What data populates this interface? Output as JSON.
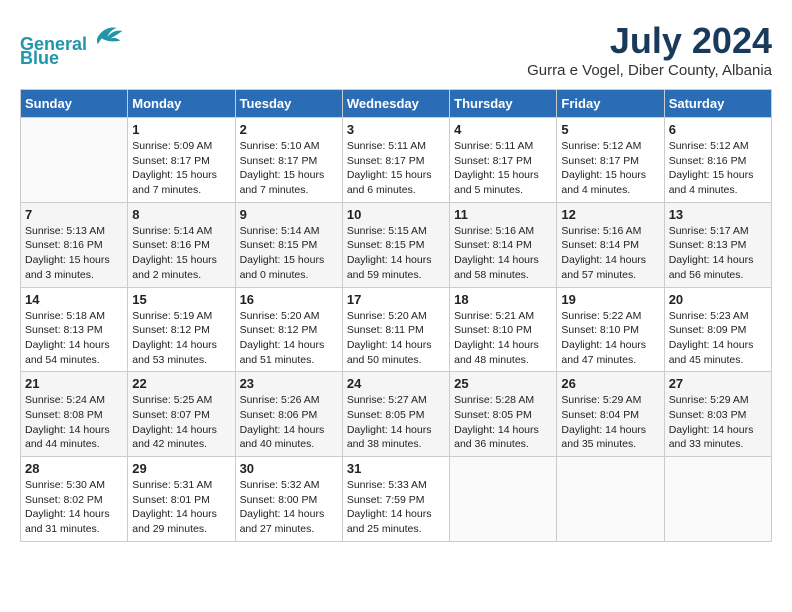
{
  "header": {
    "logo_line1": "General",
    "logo_line2": "Blue",
    "month_year": "July 2024",
    "location": "Gurra e Vogel, Diber County, Albania"
  },
  "weekdays": [
    "Sunday",
    "Monday",
    "Tuesday",
    "Wednesday",
    "Thursday",
    "Friday",
    "Saturday"
  ],
  "weeks": [
    [
      {
        "day": "",
        "info": ""
      },
      {
        "day": "1",
        "info": "Sunrise: 5:09 AM\nSunset: 8:17 PM\nDaylight: 15 hours\nand 7 minutes."
      },
      {
        "day": "2",
        "info": "Sunrise: 5:10 AM\nSunset: 8:17 PM\nDaylight: 15 hours\nand 7 minutes."
      },
      {
        "day": "3",
        "info": "Sunrise: 5:11 AM\nSunset: 8:17 PM\nDaylight: 15 hours\nand 6 minutes."
      },
      {
        "day": "4",
        "info": "Sunrise: 5:11 AM\nSunset: 8:17 PM\nDaylight: 15 hours\nand 5 minutes."
      },
      {
        "day": "5",
        "info": "Sunrise: 5:12 AM\nSunset: 8:17 PM\nDaylight: 15 hours\nand 4 minutes."
      },
      {
        "day": "6",
        "info": "Sunrise: 5:12 AM\nSunset: 8:16 PM\nDaylight: 15 hours\nand 4 minutes."
      }
    ],
    [
      {
        "day": "7",
        "info": "Sunrise: 5:13 AM\nSunset: 8:16 PM\nDaylight: 15 hours\nand 3 minutes."
      },
      {
        "day": "8",
        "info": "Sunrise: 5:14 AM\nSunset: 8:16 PM\nDaylight: 15 hours\nand 2 minutes."
      },
      {
        "day": "9",
        "info": "Sunrise: 5:14 AM\nSunset: 8:15 PM\nDaylight: 15 hours\nand 0 minutes."
      },
      {
        "day": "10",
        "info": "Sunrise: 5:15 AM\nSunset: 8:15 PM\nDaylight: 14 hours\nand 59 minutes."
      },
      {
        "day": "11",
        "info": "Sunrise: 5:16 AM\nSunset: 8:14 PM\nDaylight: 14 hours\nand 58 minutes."
      },
      {
        "day": "12",
        "info": "Sunrise: 5:16 AM\nSunset: 8:14 PM\nDaylight: 14 hours\nand 57 minutes."
      },
      {
        "day": "13",
        "info": "Sunrise: 5:17 AM\nSunset: 8:13 PM\nDaylight: 14 hours\nand 56 minutes."
      }
    ],
    [
      {
        "day": "14",
        "info": "Sunrise: 5:18 AM\nSunset: 8:13 PM\nDaylight: 14 hours\nand 54 minutes."
      },
      {
        "day": "15",
        "info": "Sunrise: 5:19 AM\nSunset: 8:12 PM\nDaylight: 14 hours\nand 53 minutes."
      },
      {
        "day": "16",
        "info": "Sunrise: 5:20 AM\nSunset: 8:12 PM\nDaylight: 14 hours\nand 51 minutes."
      },
      {
        "day": "17",
        "info": "Sunrise: 5:20 AM\nSunset: 8:11 PM\nDaylight: 14 hours\nand 50 minutes."
      },
      {
        "day": "18",
        "info": "Sunrise: 5:21 AM\nSunset: 8:10 PM\nDaylight: 14 hours\nand 48 minutes."
      },
      {
        "day": "19",
        "info": "Sunrise: 5:22 AM\nSunset: 8:10 PM\nDaylight: 14 hours\nand 47 minutes."
      },
      {
        "day": "20",
        "info": "Sunrise: 5:23 AM\nSunset: 8:09 PM\nDaylight: 14 hours\nand 45 minutes."
      }
    ],
    [
      {
        "day": "21",
        "info": "Sunrise: 5:24 AM\nSunset: 8:08 PM\nDaylight: 14 hours\nand 44 minutes."
      },
      {
        "day": "22",
        "info": "Sunrise: 5:25 AM\nSunset: 8:07 PM\nDaylight: 14 hours\nand 42 minutes."
      },
      {
        "day": "23",
        "info": "Sunrise: 5:26 AM\nSunset: 8:06 PM\nDaylight: 14 hours\nand 40 minutes."
      },
      {
        "day": "24",
        "info": "Sunrise: 5:27 AM\nSunset: 8:05 PM\nDaylight: 14 hours\nand 38 minutes."
      },
      {
        "day": "25",
        "info": "Sunrise: 5:28 AM\nSunset: 8:05 PM\nDaylight: 14 hours\nand 36 minutes."
      },
      {
        "day": "26",
        "info": "Sunrise: 5:29 AM\nSunset: 8:04 PM\nDaylight: 14 hours\nand 35 minutes."
      },
      {
        "day": "27",
        "info": "Sunrise: 5:29 AM\nSunset: 8:03 PM\nDaylight: 14 hours\nand 33 minutes."
      }
    ],
    [
      {
        "day": "28",
        "info": "Sunrise: 5:30 AM\nSunset: 8:02 PM\nDaylight: 14 hours\nand 31 minutes."
      },
      {
        "day": "29",
        "info": "Sunrise: 5:31 AM\nSunset: 8:01 PM\nDaylight: 14 hours\nand 29 minutes."
      },
      {
        "day": "30",
        "info": "Sunrise: 5:32 AM\nSunset: 8:00 PM\nDaylight: 14 hours\nand 27 minutes."
      },
      {
        "day": "31",
        "info": "Sunrise: 5:33 AM\nSunset: 7:59 PM\nDaylight: 14 hours\nand 25 minutes."
      },
      {
        "day": "",
        "info": ""
      },
      {
        "day": "",
        "info": ""
      },
      {
        "day": "",
        "info": ""
      }
    ]
  ]
}
